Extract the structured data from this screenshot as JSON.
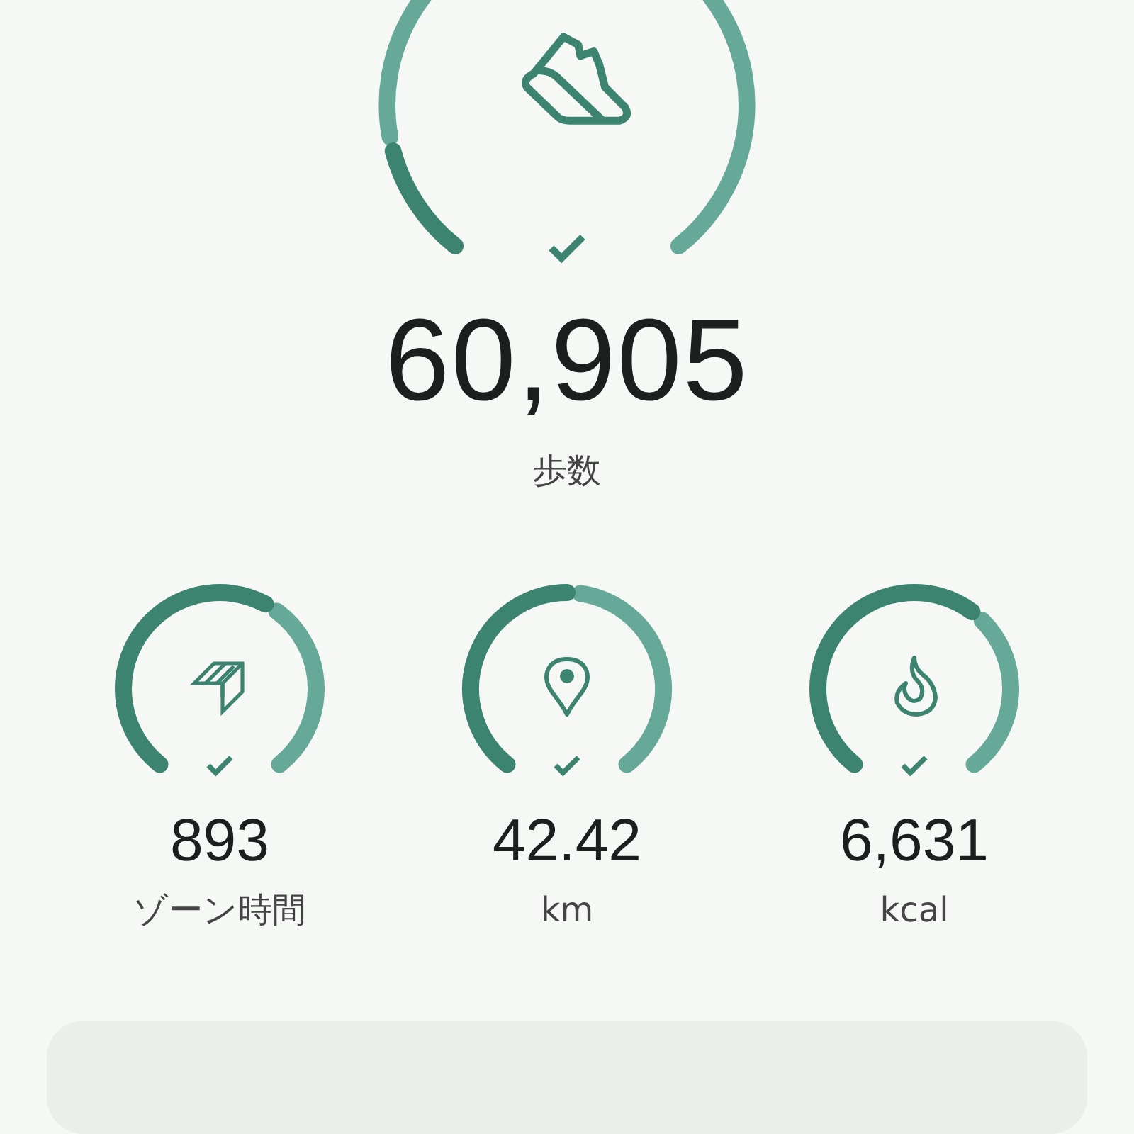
{
  "steps": {
    "kind": "steps",
    "value": "60,905",
    "label": "歩数",
    "goal_met": true
  },
  "metrics": [
    {
      "kind": "zone",
      "value": "893",
      "label": "ゾーン時間",
      "goal_met": true
    },
    {
      "kind": "distance",
      "value": "42.42",
      "label": "km",
      "goal_met": true
    },
    {
      "kind": "energy",
      "value": "6,631",
      "label": "kcal",
      "goal_met": true
    }
  ]
}
